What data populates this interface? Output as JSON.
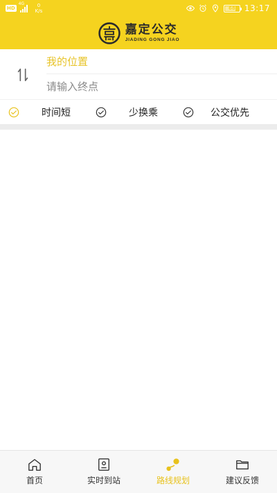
{
  "status_bar": {
    "network_badge": "HD",
    "network_type": "4G",
    "speed_value": "0",
    "speed_unit": "K/s",
    "battery": "68",
    "time": "13:17",
    "icons": [
      "eye-icon",
      "alarm-icon",
      "location-icon",
      "battery-icon"
    ]
  },
  "header": {
    "logo_text": "嘉定公交",
    "logo_subtitle": "JIADING GONG JIAO",
    "brand_color": "#f5d31f"
  },
  "route": {
    "start_label": "我的位置",
    "end_placeholder": "请输入终点",
    "start_color": "#e8c42a"
  },
  "options": [
    {
      "label": "时间短",
      "selected": true
    },
    {
      "label": "少换乘",
      "selected": false
    },
    {
      "label": "公交优先",
      "selected": false
    }
  ],
  "nav": {
    "items": [
      {
        "label": "首页",
        "icon": "home-icon",
        "active": false
      },
      {
        "label": "实时到站",
        "icon": "realtime-icon",
        "active": false
      },
      {
        "label": "路线规划",
        "icon": "route-plan-icon",
        "active": true
      },
      {
        "label": "建议反馈",
        "icon": "folder-icon",
        "active": false
      }
    ],
    "active_color": "#e8c21d"
  }
}
